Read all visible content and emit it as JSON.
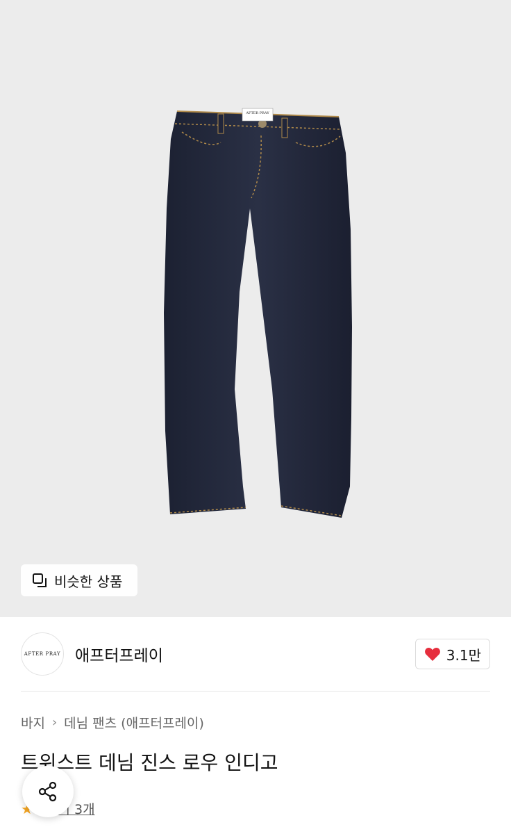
{
  "hero": {
    "label_text": "AFTER PRAY",
    "similar_button_label": "비슷한 상품"
  },
  "brand": {
    "logo_text": "AFTER PRAY",
    "name": "애프터프레이",
    "like_count": "3.1만"
  },
  "breadcrumb": {
    "category": "바지",
    "subcategory": "데님 팬츠 (애프터프레이)"
  },
  "product": {
    "title": "트위스트 데님 진스 로우 인디고",
    "review_label": "후기 3개",
    "rating_prefix": "·"
  },
  "colors": {
    "accent_heart": "#e62e3d",
    "star": "#f5a623",
    "denim": "#23283a"
  },
  "icons": {
    "similar": "similar-products-icon",
    "heart": "heart-icon",
    "share": "share-icon",
    "star": "star-icon"
  }
}
